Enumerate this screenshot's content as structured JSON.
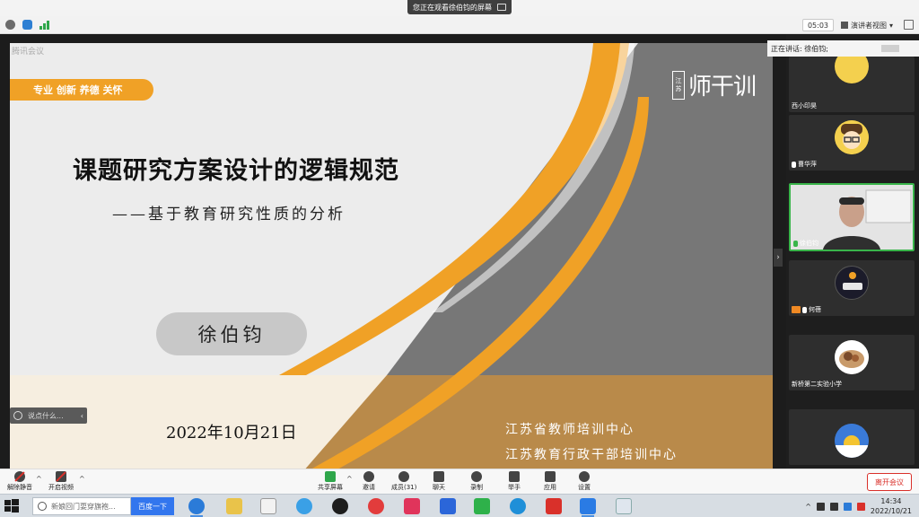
{
  "share_banner": {
    "text": "您正在观看徐伯钧的屏幕"
  },
  "top_bar": {
    "timer": "05:03",
    "view_mode": "演讲者视图",
    "view_caret": "▾"
  },
  "slide": {
    "watermark": "腾讯会议",
    "slogan": "专业 创新 养德 关怀",
    "logo_box_top": "江",
    "logo_box_bottom": "苏",
    "logo_text": "师干训",
    "title": "课题研究方案设计的逻辑规范",
    "subtitle": "——基于教育研究性质的分析",
    "author": "徐伯钧",
    "date": "2022年10月21日",
    "org_line1": "江苏省教师培训中心",
    "org_line2": "江苏教育行政干部培训中心",
    "colors": {
      "orange": "#f0a126",
      "gray": "#777777",
      "bronze": "#b98a4a",
      "cream": "#f6eee0"
    }
  },
  "chat": {
    "placeholder": "说点什么...",
    "collapse": "‹"
  },
  "speaking": {
    "text": "正在讲话: 徐伯钧;"
  },
  "panel": {
    "collapse": "›",
    "participants": [
      {
        "name": "西小印昊"
      },
      {
        "name": "曹华萍"
      },
      {
        "name": "徐伯钧"
      },
      {
        "name": "何蓓"
      },
      {
        "name": "新桥第二实验小学"
      },
      {
        "name": ""
      }
    ]
  },
  "toolbar": {
    "mute": "解除静音",
    "video": "开启视频",
    "share": "共享屏幕",
    "invite": "邀请",
    "members": "成员(31)",
    "chat": "聊天",
    "record": "录制",
    "raise_hand": "举手",
    "apps": "应用",
    "settings": "设置",
    "leave": "离开会议",
    "caret": "^"
  },
  "taskbar": {
    "search_placeholder": "新娘回门耍穿旗袍...",
    "search_button": "百度一下",
    "time": "14:34",
    "date": "2022/10/21",
    "tray_caret": "^"
  }
}
